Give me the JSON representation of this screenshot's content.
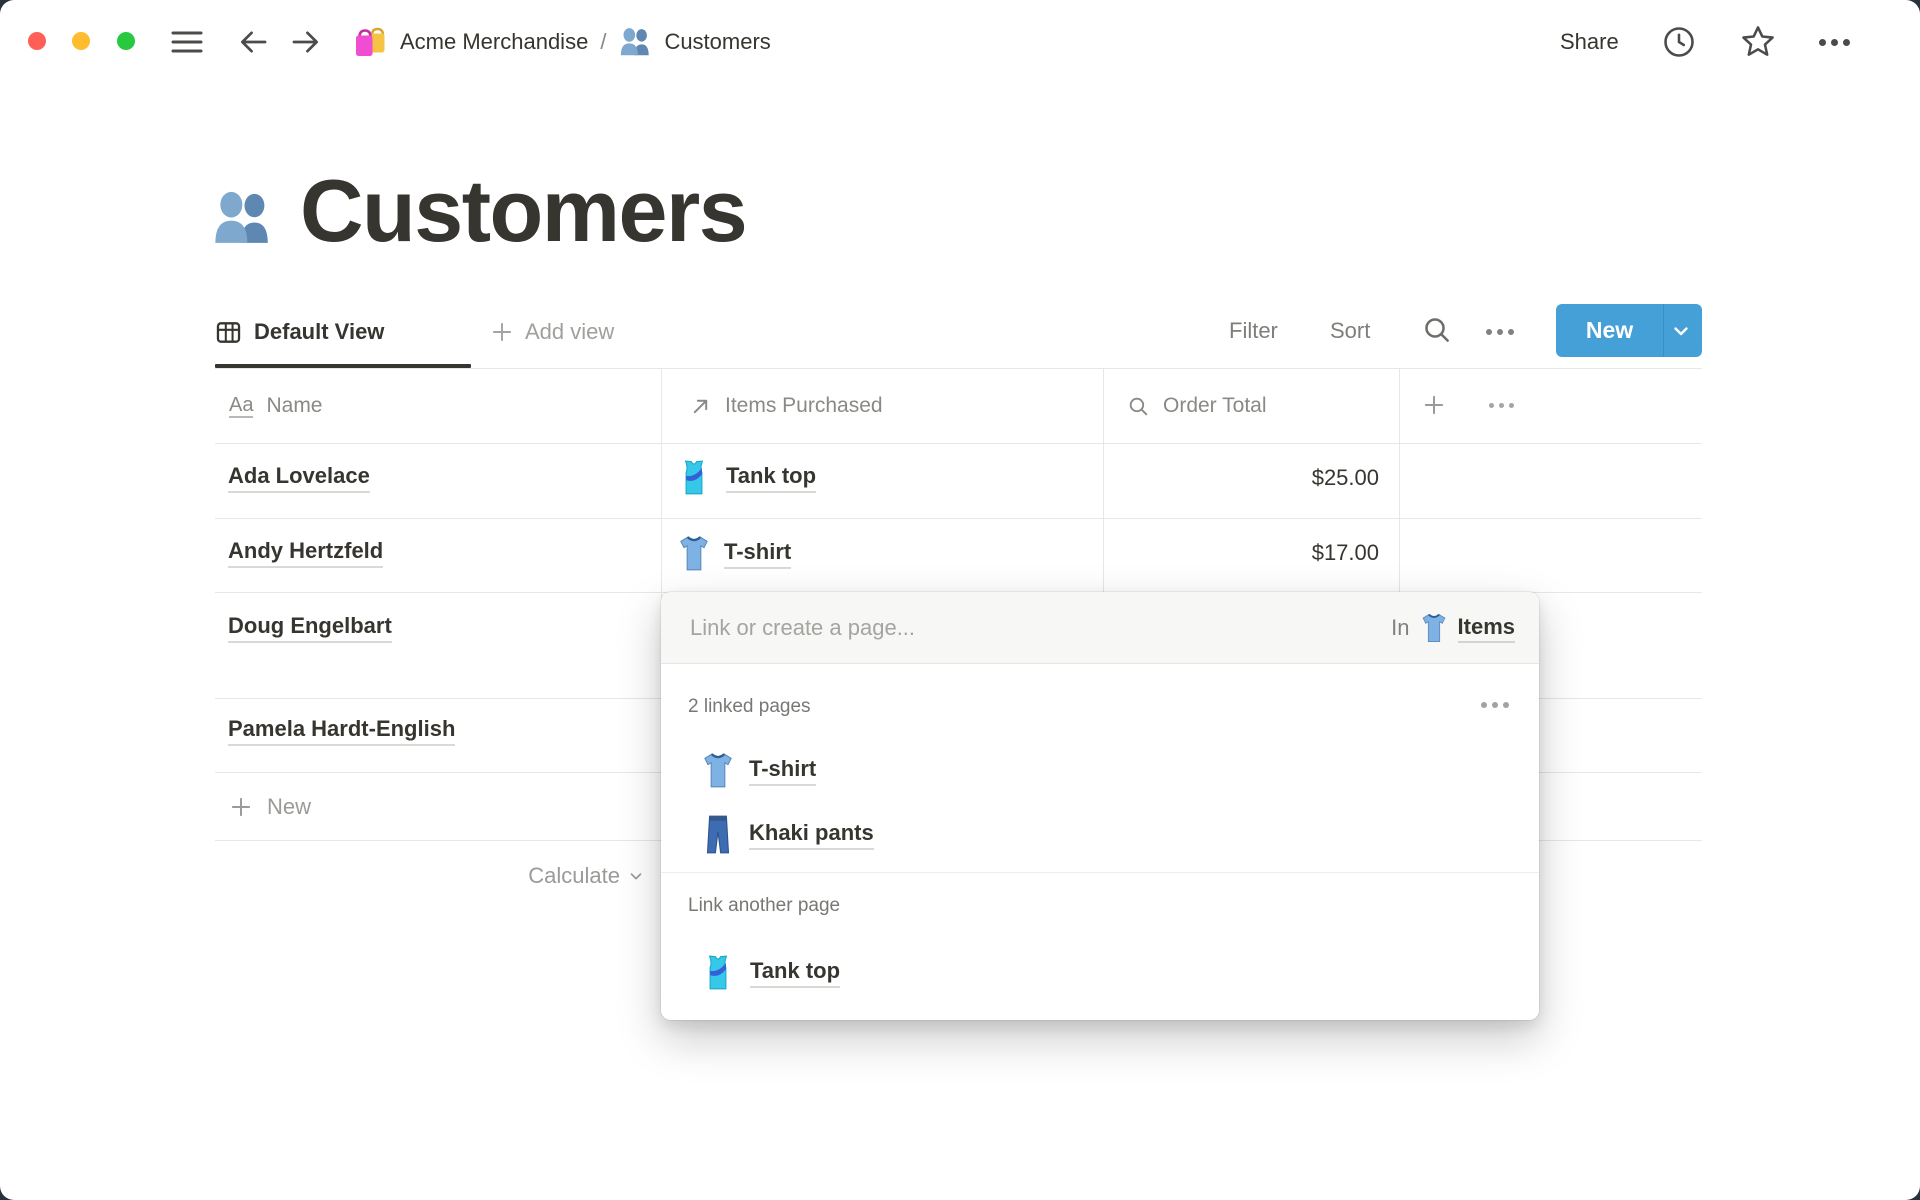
{
  "colors": {
    "accent_blue": "#45A0D8",
    "text_dark": "#37352F",
    "text_gray": "#82817D",
    "table_border": "#E8E7E5",
    "popup_header_bg": "#F7F7F5",
    "traffic_red": "#FF5F57",
    "traffic_yellow": "#FEBC2E",
    "traffic_green": "#28C840"
  },
  "icons": {
    "title_property_glyph": "Aa",
    "workspace_icon": "shopping-bags-emoji",
    "page_icon": "busts-emoji"
  },
  "topbar": {
    "breadcrumb": {
      "workspace": "Acme Merchandise",
      "separator": "/",
      "page": "Customers"
    },
    "share_label": "Share"
  },
  "page": {
    "title": "Customers"
  },
  "view_bar": {
    "active_view": "Default View",
    "add_view_label": "Add view",
    "filter_label": "Filter",
    "sort_label": "Sort",
    "new_button_label": "New"
  },
  "table": {
    "columns": [
      {
        "label": "Name",
        "icon": "title-property-icon"
      },
      {
        "label": "Items Purchased",
        "icon": "relation-property-icon"
      },
      {
        "label": "Order Total",
        "icon": "rollup-property-icon"
      }
    ],
    "rows": [
      {
        "name": "Ada Lovelace",
        "item": "Tank top",
        "item_icon": "tank-top-emoji",
        "total": "$25.00"
      },
      {
        "name": "Andy Hertzfeld",
        "item": "T-shirt",
        "item_icon": "tshirt-emoji",
        "total": "$17.00"
      },
      {
        "name": "Doug Engelbart"
      },
      {
        "name": "Pamela Hardt-English"
      }
    ],
    "new_row_label": "New",
    "calculate_label": "Calculate"
  },
  "popup": {
    "input_placeholder": "Link or create a page...",
    "scope_prefix": "In",
    "scope_page": "Items",
    "scope_icon": "tshirt-emoji",
    "linked_section_label": "2 linked pages",
    "linked_pages": [
      {
        "label": "T-shirt",
        "icon": "tshirt-emoji"
      },
      {
        "label": "Khaki pants",
        "icon": "jeans-emoji"
      }
    ],
    "other_section_label": "Link another page",
    "other_pages": [
      {
        "label": "Tank top",
        "icon": "tank-top-emoji"
      }
    ]
  }
}
